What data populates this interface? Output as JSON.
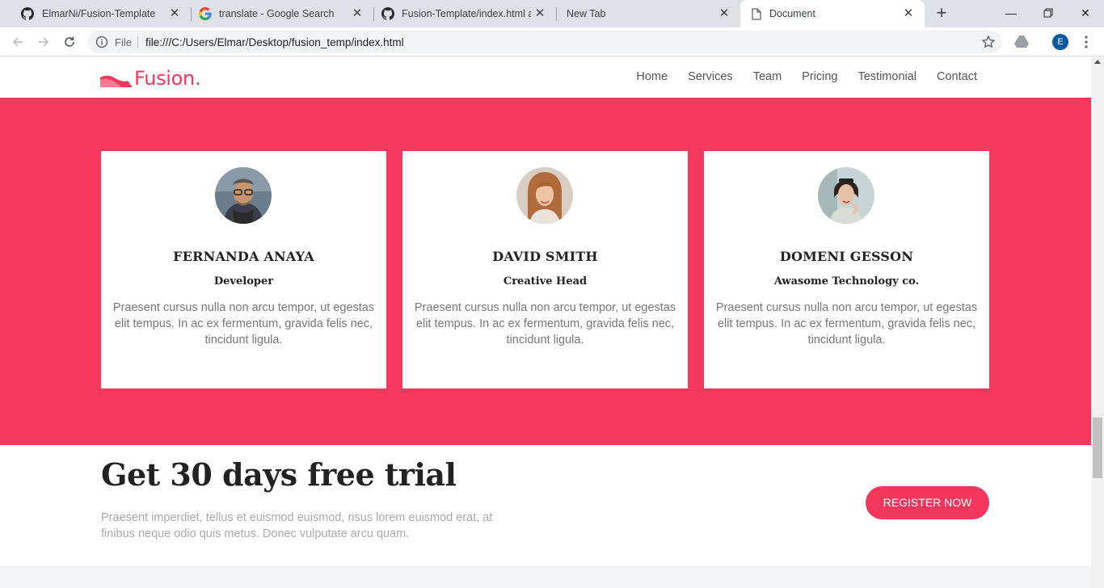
{
  "browser": {
    "tabs": [
      {
        "title": "ElmarNi/Fusion-Template",
        "icon": "github-icon"
      },
      {
        "title": "translate - Google Search",
        "icon": "google-icon"
      },
      {
        "title": "Fusion-Template/index.html at",
        "icon": "github-icon"
      },
      {
        "title": "New Tab",
        "icon": "none"
      },
      {
        "title": "Document",
        "icon": "document-icon"
      }
    ],
    "address": {
      "scheme_label": "File",
      "url": "file:///C:/Users/Elmar/Desktop/fusion_temp/index.html"
    },
    "profile_initial": "E"
  },
  "site": {
    "brand": "Fusion.",
    "brand_color": "#f5365c",
    "nav": [
      "Home",
      "Services",
      "Team",
      "Pricing",
      "Testimonial",
      "Contact"
    ]
  },
  "team": {
    "background": "#f5385b",
    "members": [
      {
        "name": "FERNANDA ANAYA",
        "role": "Developer",
        "text": "Praesent cursus nulla non arcu tempor, ut egestas elit tempus. In ac ex fermentum, gravida felis nec, tincidunt ligula."
      },
      {
        "name": "DAVID SMITH",
        "role": "Creative Head",
        "text": "Praesent cursus nulla non arcu tempor, ut egestas elit tempus. In ac ex fermentum, gravida felis nec, tincidunt ligula."
      },
      {
        "name": "DOMENI GESSON",
        "role": "Awasome Technology co.",
        "text": "Praesent cursus nulla non arcu tempor, ut egestas elit tempus. In ac ex fermentum, gravida felis nec, tincidunt ligula."
      }
    ]
  },
  "trial": {
    "title": "Get 30 days free trial",
    "text": "Praesent imperdiet, tellus et euismod euismod, risus lorem euismod erat, at finibus neque odio quis metus. Donec vulputate arcu quam.",
    "button": "REGISTER NOW"
  }
}
